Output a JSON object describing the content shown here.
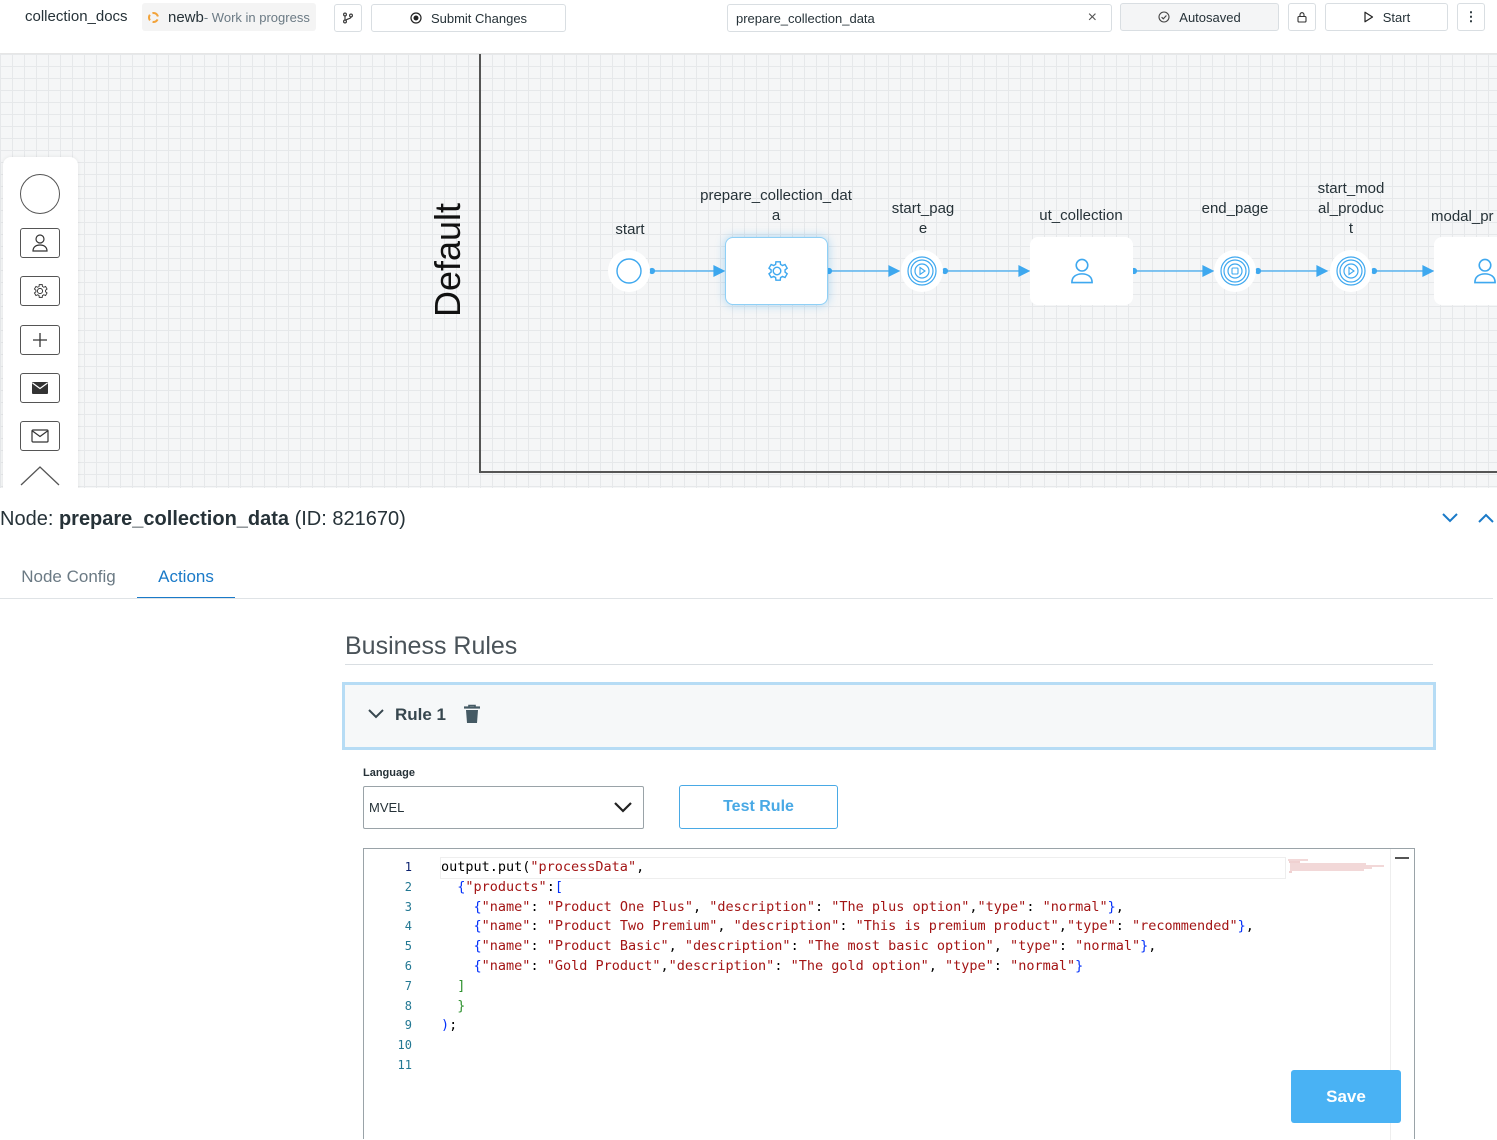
{
  "topbar": {
    "project": "collection_docs",
    "branch_name": "newb",
    "branch_status": "- Work in progress",
    "submit_label": "Submit Changes",
    "search_value": "prepare_collection_data",
    "clear_symbol": "×",
    "autosaved_label": "Autosaved",
    "start_label": "Start",
    "more_symbol": "⋮"
  },
  "canvas": {
    "lane_label": "Default",
    "nodes": {
      "start": "start",
      "prepare": "prepare_collection_data",
      "start_page": "start_page",
      "ut_collection": "ut_collection",
      "end_page": "end_page",
      "start_modal_product": "start_modal_product",
      "modal_pr": "modal_pr"
    }
  },
  "node_panel": {
    "prefix": "Node:",
    "name": "prepare_collection_data",
    "id_text": "(ID: 821670)",
    "tabs": {
      "node_config": "Node Config",
      "actions": "Actions"
    },
    "section_title": "Business Rules",
    "rule_label": "Rule 1",
    "language_label": "Language",
    "language_value": "MVEL",
    "test_rule_label": "Test Rule",
    "save_label": "Save"
  },
  "editor": {
    "line_numbers": [
      "1",
      "2",
      "3",
      "4",
      "5",
      "6",
      "7",
      "8",
      "9",
      "10",
      "11"
    ]
  },
  "colors": {
    "accent": "#49b2f4",
    "tab_active": "#1a7ac8",
    "branch_dot": "#f2a33a",
    "flow_line": "#3ea8ef"
  }
}
